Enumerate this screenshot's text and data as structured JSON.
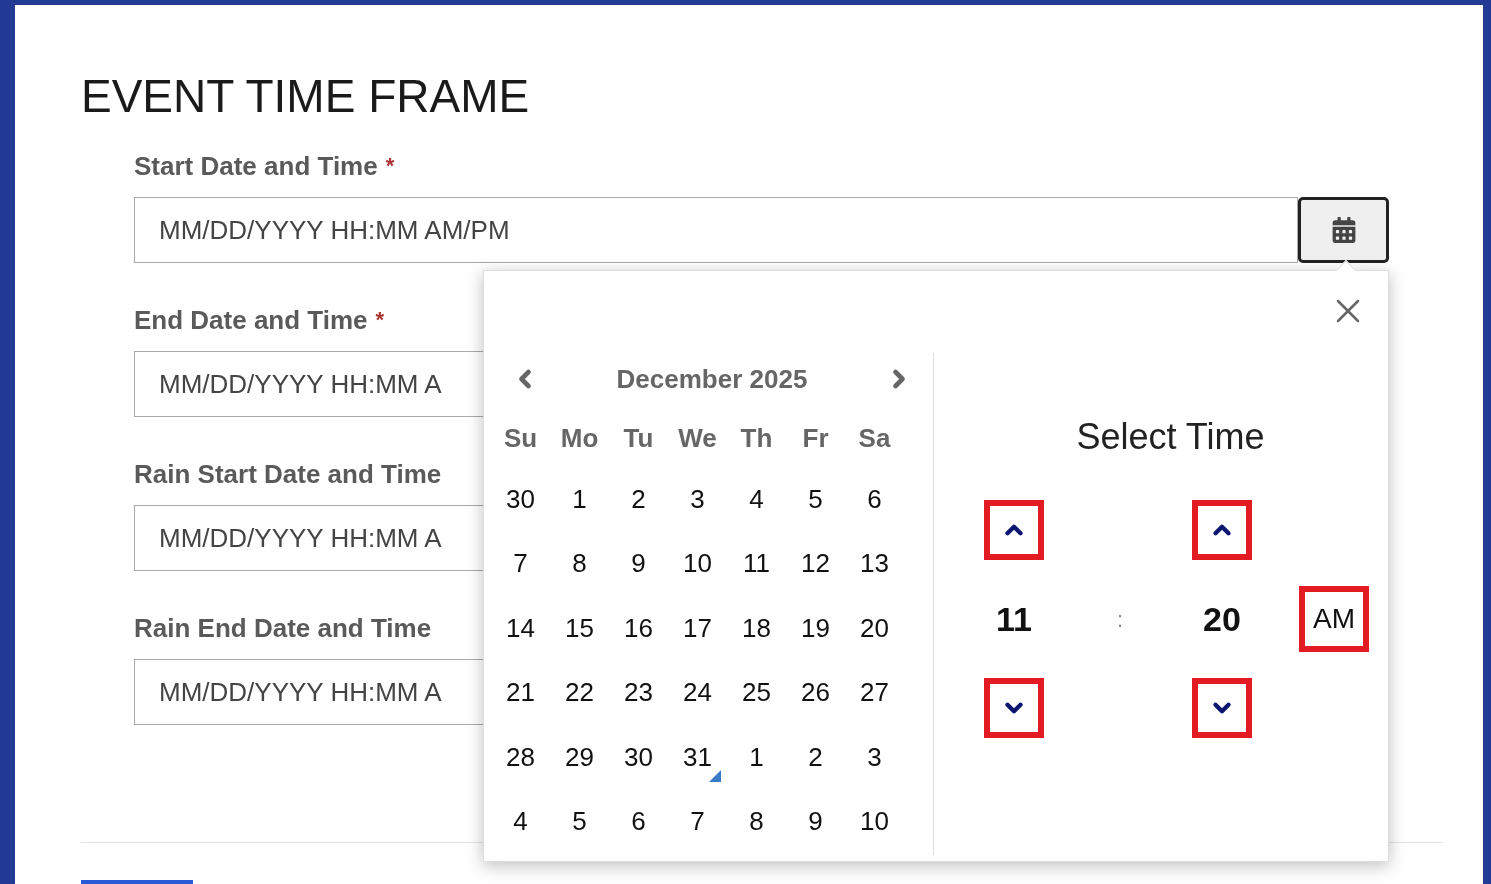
{
  "page": {
    "title": "EVENT TIME FRAME"
  },
  "fields": [
    {
      "label": "Start Date and Time",
      "required_mark": "*",
      "placeholder": "MM/DD/YYYY HH:MM AM/PM",
      "calendar_button": true
    },
    {
      "label": "End Date and Time",
      "required_mark": "*",
      "placeholder": "MM/DD/YYYY HH:MM A",
      "calendar_button": false
    },
    {
      "label": "Rain Start Date and Time",
      "placeholder": "MM/DD/YYYY HH:MM A",
      "calendar_button": false
    },
    {
      "label": "Rain End Date and Time",
      "placeholder": "MM/DD/YYYY HH:MM A",
      "calendar_button": false
    }
  ],
  "picker": {
    "month": "December 2025",
    "weekdays": [
      "Su",
      "Mo",
      "Tu",
      "We",
      "Th",
      "Fr",
      "Sa"
    ],
    "weeks": [
      [
        {
          "day": "30",
          "today": false
        },
        {
          "day": "1",
          "today": false
        },
        {
          "day": "2",
          "today": false
        },
        {
          "day": "3",
          "today": false
        },
        {
          "day": "4",
          "today": false
        },
        {
          "day": "5",
          "today": false
        },
        {
          "day": "6",
          "today": false
        }
      ],
      [
        {
          "day": "7",
          "today": false
        },
        {
          "day": "8",
          "today": false
        },
        {
          "day": "9",
          "today": false
        },
        {
          "day": "10",
          "today": false
        },
        {
          "day": "11",
          "today": false
        },
        {
          "day": "12",
          "today": false
        },
        {
          "day": "13",
          "today": false
        }
      ],
      [
        {
          "day": "14",
          "today": false
        },
        {
          "day": "15",
          "today": false
        },
        {
          "day": "16",
          "today": false
        },
        {
          "day": "17",
          "today": false
        },
        {
          "day": "18",
          "today": false
        },
        {
          "day": "19",
          "today": false
        },
        {
          "day": "20",
          "today": false
        }
      ],
      [
        {
          "day": "21",
          "today": false
        },
        {
          "day": "22",
          "today": false
        },
        {
          "day": "23",
          "today": false
        },
        {
          "day": "24",
          "today": false
        },
        {
          "day": "25",
          "today": false
        },
        {
          "day": "26",
          "today": false
        },
        {
          "day": "27",
          "today": false
        }
      ],
      [
        {
          "day": "28",
          "today": false
        },
        {
          "day": "29",
          "today": false
        },
        {
          "day": "30",
          "today": false
        },
        {
          "day": "31",
          "today": true
        },
        {
          "day": "1",
          "today": false
        },
        {
          "day": "2",
          "today": false
        },
        {
          "day": "3",
          "today": false
        }
      ],
      [
        {
          "day": "4",
          "today": false
        },
        {
          "day": "5",
          "today": false
        },
        {
          "day": "6",
          "today": false
        },
        {
          "day": "7",
          "today": false
        },
        {
          "day": "8",
          "today": false
        },
        {
          "day": "9",
          "today": false
        },
        {
          "day": "10",
          "today": false
        }
      ]
    ],
    "time": {
      "title": "Select Time",
      "hour": "11",
      "separator": ":",
      "minute": "20",
      "period": "AM"
    }
  }
}
